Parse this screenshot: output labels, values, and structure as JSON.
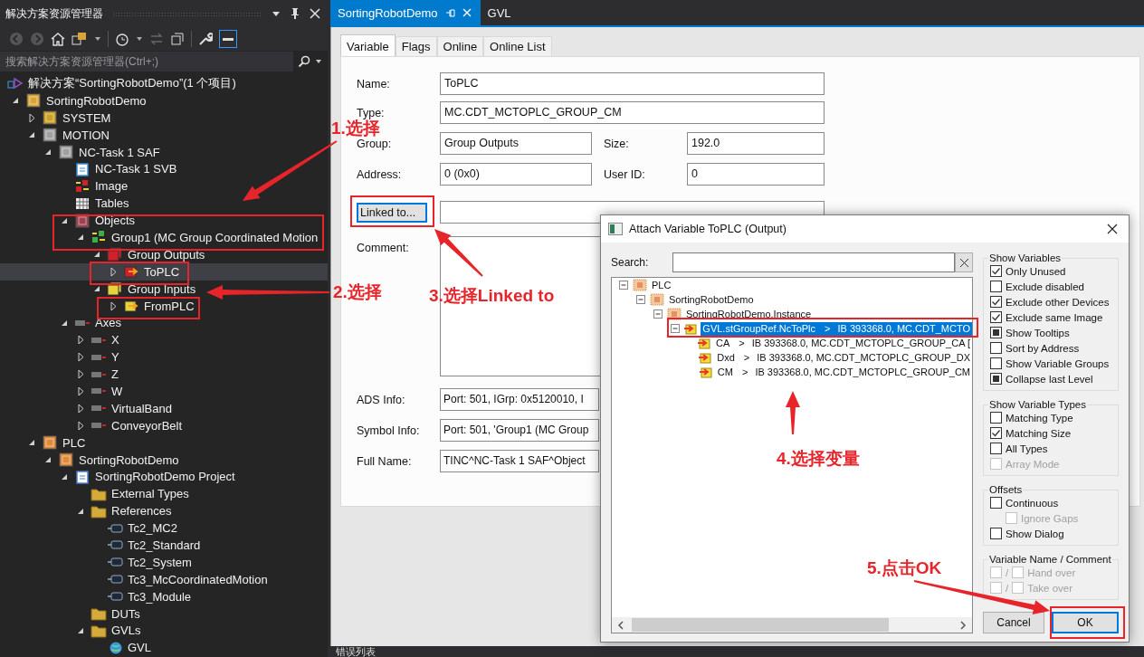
{
  "explorer": {
    "title": "解决方案资源管理器",
    "search": {
      "placeholder": "搜索解决方案资源管理器(Ctrl+;)"
    },
    "tree": [
      {
        "label": "解决方案“SortingRobotDemo”(1 个项目)",
        "kind": "solution",
        "selected": false,
        "children": [
          {
            "label": "SortingRobotDemo",
            "kind": "project",
            "expanded": true,
            "selected": false,
            "children": [
              {
                "label": "SYSTEM",
                "kind": "system",
                "expanded": false,
                "selected": false
              },
              {
                "label": "MOTION",
                "kind": "motion",
                "expanded": true,
                "selected": false,
                "children": [
                  {
                    "label": "NC-Task 1 SAF",
                    "kind": "task",
                    "expanded": true,
                    "selected": false,
                    "children": [
                      {
                        "label": "NC-Task 1 SVB",
                        "kind": "svb",
                        "selected": false
                      },
                      {
                        "label": "Image",
                        "kind": "image",
                        "selected": false
                      },
                      {
                        "label": "Tables",
                        "kind": "tables",
                        "selected": false
                      },
                      {
                        "label": "Objects",
                        "kind": "objects",
                        "expanded": true,
                        "selected": false,
                        "children": [
                          {
                            "label": "Group1 (MC Group Coordinated Motion",
                            "kind": "group",
                            "expanded": true,
                            "selected": false,
                            "children": [
                              {
                                "label": "Group Outputs",
                                "kind": "outputs",
                                "expanded": true,
                                "selected": false,
                                "children": [
                                  {
                                    "label": "ToPLC",
                                    "kind": "output-var",
                                    "expanded": false,
                                    "selected": true
                                  }
                                ]
                              },
                              {
                                "label": "Group Inputs",
                                "kind": "inputs",
                                "expanded": true,
                                "selected": false,
                                "children": [
                                  {
                                    "label": "FromPLC",
                                    "kind": "input-var",
                                    "expanded": false,
                                    "selected": false
                                  }
                                ]
                              }
                            ]
                          }
                        ]
                      },
                      {
                        "label": "Axes",
                        "kind": "axes",
                        "expanded": true,
                        "selected": false,
                        "children": [
                          {
                            "label": "X",
                            "kind": "axis",
                            "expanded": false,
                            "selected": false
                          },
                          {
                            "label": "Y",
                            "kind": "axis",
                            "expanded": false,
                            "selected": false
                          },
                          {
                            "label": "Z",
                            "kind": "axis",
                            "expanded": false,
                            "selected": false
                          },
                          {
                            "label": "W",
                            "kind": "axis",
                            "expanded": false,
                            "selected": false
                          },
                          {
                            "label": "VirtualBand",
                            "kind": "axis",
                            "expanded": false,
                            "selected": false
                          },
                          {
                            "label": "ConveyorBelt",
                            "kind": "axis",
                            "expanded": false,
                            "selected": false
                          }
                        ]
                      }
                    ]
                  }
                ]
              },
              {
                "label": "PLC",
                "kind": "plc",
                "expanded": true,
                "selected": false,
                "children": [
                  {
                    "label": "SortingRobotDemo",
                    "kind": "plc",
                    "expanded": true,
                    "selected": false,
                    "children": [
                      {
                        "label": "SortingRobotDemo Project",
                        "kind": "plc-project",
                        "expanded": true,
                        "selected": false,
                        "children": [
                          {
                            "label": "External Types",
                            "kind": "folder",
                            "selected": false
                          },
                          {
                            "label": "References",
                            "kind": "folder",
                            "expanded": true,
                            "selected": false,
                            "children": [
                              {
                                "label": "Tc2_MC2",
                                "kind": "reference",
                                "selected": false
                              },
                              {
                                "label": "Tc2_Standard",
                                "kind": "reference",
                                "selected": false
                              },
                              {
                                "label": "Tc2_System",
                                "kind": "reference",
                                "selected": false
                              },
                              {
                                "label": "Tc3_McCoordinatedMotion",
                                "kind": "reference",
                                "selected": false
                              },
                              {
                                "label": "Tc3_Module",
                                "kind": "reference",
                                "selected": false
                              }
                            ]
                          },
                          {
                            "label": "DUTs",
                            "kind": "folder",
                            "selected": false
                          },
                          {
                            "label": "GVLs",
                            "kind": "folder",
                            "expanded": true,
                            "selected": false,
                            "children": [
                              {
                                "label": "GVL",
                                "kind": "gvl",
                                "selected": false
                              }
                            ]
                          }
                        ]
                      }
                    ]
                  }
                ]
              }
            ]
          }
        ]
      }
    ]
  },
  "doc_tabs": [
    {
      "label": "SortingRobotDemo",
      "selected": true
    },
    {
      "label": "GVL",
      "selected": false
    }
  ],
  "editor": {
    "tabs": [
      {
        "label": "Variable",
        "selected": true
      },
      {
        "label": "Flags",
        "selected": false
      },
      {
        "label": "Online",
        "selected": false
      },
      {
        "label": "Online List",
        "selected": false
      }
    ],
    "name": {
      "label": "Name:",
      "value": "ToPLC"
    },
    "type": {
      "label": "Type:",
      "value": "MC.CDT_MCTOPLC_GROUP_CM"
    },
    "group": {
      "label": "Group:",
      "value": "Group Outputs"
    },
    "size": {
      "label": "Size:",
      "value": "192.0"
    },
    "address": {
      "label": "Address:",
      "value": "0 (0x0)"
    },
    "user_id": {
      "label": "User ID:",
      "value": "0"
    },
    "linked_button": "Linked to...",
    "comment": {
      "label": "Comment:"
    },
    "ads_info": {
      "label": "ADS Info:",
      "value": "Port: 501, IGrp: 0x5120010, I"
    },
    "symbol_info": {
      "label": "Symbol Info:",
      "value": "Port: 501, 'Group1 (MC Group"
    },
    "full_name": {
      "label": "Full Name:",
      "value": "TINC^NC-Task 1 SAF^Object"
    }
  },
  "dialog": {
    "title": "Attach Variable ToPLC (Output)",
    "search_label": "Search:",
    "tree": [
      {
        "label": "PLC",
        "kind": "plc",
        "expanded": true,
        "selected": false,
        "children": [
          {
            "label": "SortingRobotDemo",
            "kind": "plc",
            "expanded": true,
            "selected": false,
            "children": [
              {
                "label": "SortingRobotDemo.Instance",
                "kind": "plc",
                "expanded": true,
                "selected": false,
                "children": [
                  {
                    "label": "GVL.stGroupRef.NcToPlc",
                    "kind": "var",
                    "expanded": true,
                    "selected": true,
                    "separator": ">",
                    "info": "IB 393368.0, MC.CDT_MCTO",
                    "children": [
                      {
                        "label": "CA",
                        "kind": "var",
                        "selected": false,
                        "separator": ">",
                        "info": "IB 393368.0, MC.CDT_MCTOPLC_GROUP_CA ["
                      },
                      {
                        "label": "Dxd",
                        "kind": "var",
                        "selected": false,
                        "separator": ">",
                        "info": "IB 393368.0, MC.CDT_MCTOPLC_GROUP_DX"
                      },
                      {
                        "label": "CM",
                        "kind": "var",
                        "selected": false,
                        "separator": ">",
                        "info": "IB 393368.0, MC.CDT_MCTOPLC_GROUP_CM"
                      }
                    ]
                  }
                ]
              }
            ]
          }
        ]
      }
    ],
    "groups": [
      {
        "title": "Show Variables",
        "items": [
          {
            "kind": "check",
            "label": "Only Unused",
            "checked": true,
            "indeterminate": false,
            "disabled": false
          },
          {
            "kind": "check",
            "label": "Exclude disabled",
            "checked": false,
            "indeterminate": false,
            "disabled": false
          },
          {
            "kind": "check",
            "label": "Exclude other Devices",
            "checked": true,
            "indeterminate": false,
            "disabled": false
          },
          {
            "kind": "check",
            "label": "Exclude same Image",
            "checked": true,
            "indeterminate": false,
            "disabled": false
          },
          {
            "kind": "check",
            "label": "Show Tooltips",
            "checked": false,
            "indeterminate": true,
            "disabled": false
          },
          {
            "kind": "check",
            "label": "Sort by Address",
            "checked": false,
            "indeterminate": false,
            "disabled": false
          },
          {
            "kind": "check",
            "label": "Show Variable Groups",
            "checked": false,
            "indeterminate": false,
            "disabled": false
          },
          {
            "kind": "check",
            "label": "Collapse last Level",
            "checked": false,
            "indeterminate": true,
            "disabled": false
          }
        ]
      },
      {
        "title": "Show Variable Types",
        "items": [
          {
            "kind": "check",
            "label": "Matching Type",
            "checked": false,
            "indeterminate": false,
            "disabled": false
          },
          {
            "kind": "check",
            "label": "Matching Size",
            "checked": true,
            "indeterminate": false,
            "disabled": false
          },
          {
            "kind": "check",
            "label": "All Types",
            "checked": false,
            "indeterminate": false,
            "disabled": false
          },
          {
            "kind": "check",
            "label": "Array Mode",
            "checked": false,
            "indeterminate": false,
            "disabled": true
          }
        ]
      },
      {
        "title": "Offsets",
        "items": [
          {
            "kind": "check",
            "label": "Continuous",
            "checked": false,
            "indeterminate": false,
            "disabled": false
          },
          {
            "kind": "subcheck",
            "label": "Ignore Gaps",
            "checked": false,
            "indeterminate": false,
            "disabled": true
          },
          {
            "kind": "check",
            "label": "Show Dialog",
            "checked": false,
            "indeterminate": false,
            "disabled": false
          }
        ]
      },
      {
        "title": "Variable Name / Comment",
        "items": [
          {
            "kind": "pair",
            "label": "Hand over",
            "separator": "/",
            "checked": false,
            "second_checked": false,
            "disabled": true
          },
          {
            "kind": "pair",
            "label": "Take over",
            "separator": "/",
            "checked": false,
            "second_checked": false,
            "disabled": true
          }
        ]
      }
    ],
    "buttons": [
      {
        "label": "Cancel",
        "default": false
      },
      {
        "label": "OK",
        "default": true
      }
    ]
  },
  "annotations": [
    {
      "label": "1.选择"
    },
    {
      "label": "2.选择"
    },
    {
      "label": "3.选择Linked to"
    },
    {
      "label": "4.选择变量"
    },
    {
      "label": "5.点击OK"
    }
  ],
  "status_bar": {
    "label": "错误列表"
  }
}
